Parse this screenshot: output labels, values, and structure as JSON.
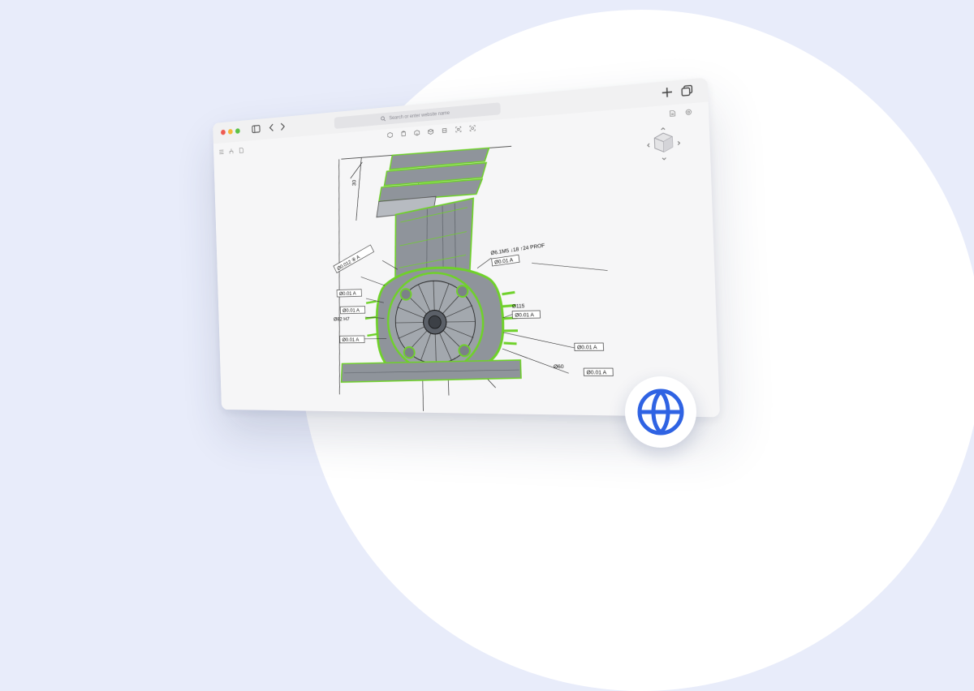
{
  "browser": {
    "address_placeholder": "Search or enter website name"
  },
  "icons": {
    "window_controls": [
      "close",
      "minimize",
      "zoom"
    ],
    "toolbar": [
      "sidebar-toggle-icon",
      "back-chevron-icon",
      "forward-chevron-icon",
      "new-tab-plus-icon",
      "tabs-overview-icon"
    ],
    "viewer_tools": [
      "view-cube-1-icon",
      "view-cube-2-icon",
      "view-cube-3-icon",
      "view-cube-4-icon",
      "view-cube-5-icon",
      "fit-view-icon",
      "focus-view-icon"
    ],
    "left_tools": [
      "list-icon",
      "tree-icon",
      "document-icon"
    ],
    "right_tools": [
      "page-icon",
      "settings-icon"
    ],
    "badge": "globe-icon"
  },
  "annotations": {
    "a1": "Ø0.012 ⑧ A",
    "a2": "Ø6.1M5  ↓18 ↑24 PROF",
    "a3": "Ø0.01 A",
    "a4": "Ø0.01 A",
    "a5": "Ø0.01 A",
    "a6": "Ø82 H7",
    "a7": "Ø115",
    "a8": "Ø0.01 A",
    "a9": "Ø0.01 A",
    "a10": "Ø0.01 A",
    "a11": "Ø60",
    "a12": "Ø0.01 A",
    "dim1": "30"
  },
  "colors": {
    "accent_globe": "#2f63e3",
    "model_green": "#6fd12a",
    "model_gray": "#8f949b",
    "background": "#e8ecfa"
  }
}
